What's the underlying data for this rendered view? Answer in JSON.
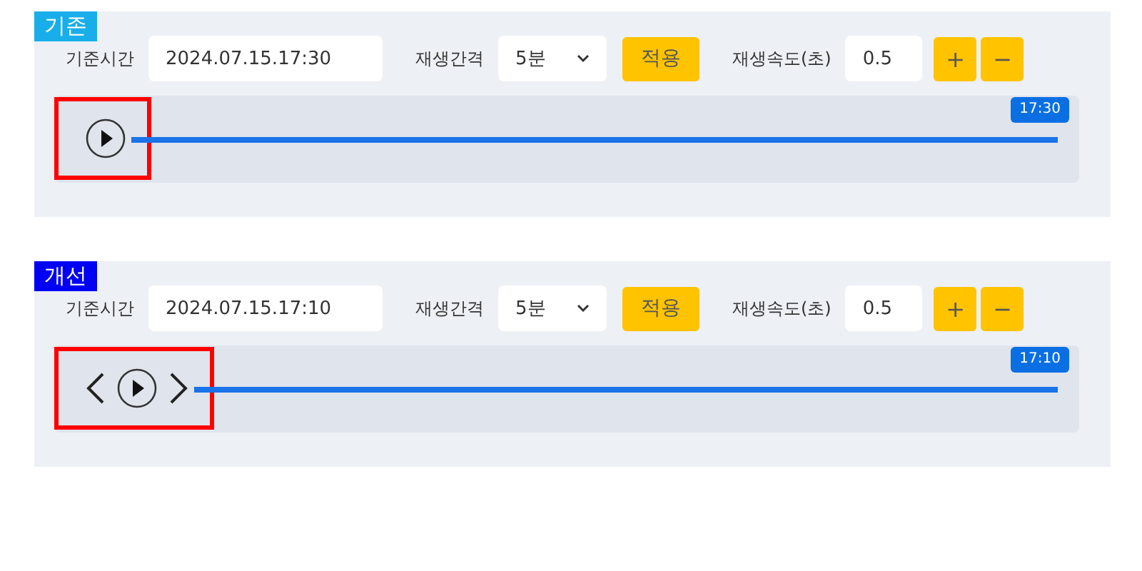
{
  "panels": [
    {
      "tag": "기존",
      "color": "#19aeea",
      "base_time_label": "기준시간",
      "base_time": "2024.07.15.17:30",
      "interval_label": "재생간격",
      "interval": "5분",
      "apply": "적용",
      "speed_label": "재생속도(초)",
      "speed": "0.5",
      "plus": "+",
      "minus": "−",
      "controls": [
        {
          "kind": "play"
        }
      ],
      "highlighted": true,
      "timeline": {
        "level": 1,
        "marker": "17:30"
      }
    },
    {
      "tag": "개선",
      "color": "#0000f5",
      "base_time_label": "기준시간",
      "base_time": "2024.07.15.17:10",
      "interval_label": "재생간격",
      "interval": "5분",
      "apply": "적용",
      "speed_label": "재생속도(초)",
      "speed": "0.5",
      "plus": "+",
      "minus": "−",
      "controls": [
        {
          "kind": "prev"
        },
        {
          "kind": "play"
        },
        {
          "kind": "next"
        }
      ],
      "highlighted": true,
      "timeline": {
        "level": 1,
        "marker": "17:10"
      }
    }
  ]
}
